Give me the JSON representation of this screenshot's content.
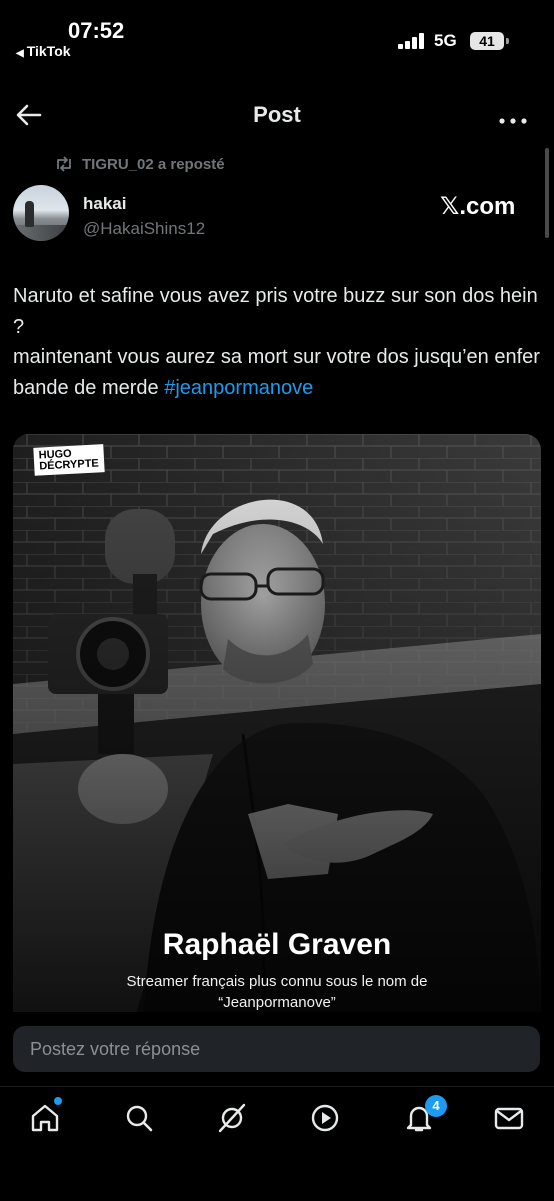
{
  "status_bar": {
    "time": "07:52",
    "back_app": "TikTok",
    "network": "5G",
    "battery": "41"
  },
  "header": {
    "title": "Post"
  },
  "repost": {
    "text": "TIGRU_02 a reposté"
  },
  "post": {
    "author_name": "hakai",
    "author_handle": "@HakaiShins12",
    "source": ".com",
    "text_lines": [
      "Naruto et safine vous avez pris votre buzz sur son dos hein ?",
      "maintenant vous aurez sa mort sur votre dos jusqu’en enfer bande de merde "
    ],
    "hashtag": "#jeanpormanove"
  },
  "media": {
    "logo_line1": "HUGO",
    "logo_line2": "DÉCRYPTE",
    "caption_title": "Raphaël Graven",
    "caption_subtitle": "Streamer français plus connu sous le nom de “Jeanpormanove”"
  },
  "reply": {
    "placeholder": "Postez votre réponse"
  },
  "nav": {
    "notifications_count": "4"
  },
  "colors": {
    "accent": "#1d9bf0",
    "background": "#000000",
    "muted": "#71767b"
  }
}
